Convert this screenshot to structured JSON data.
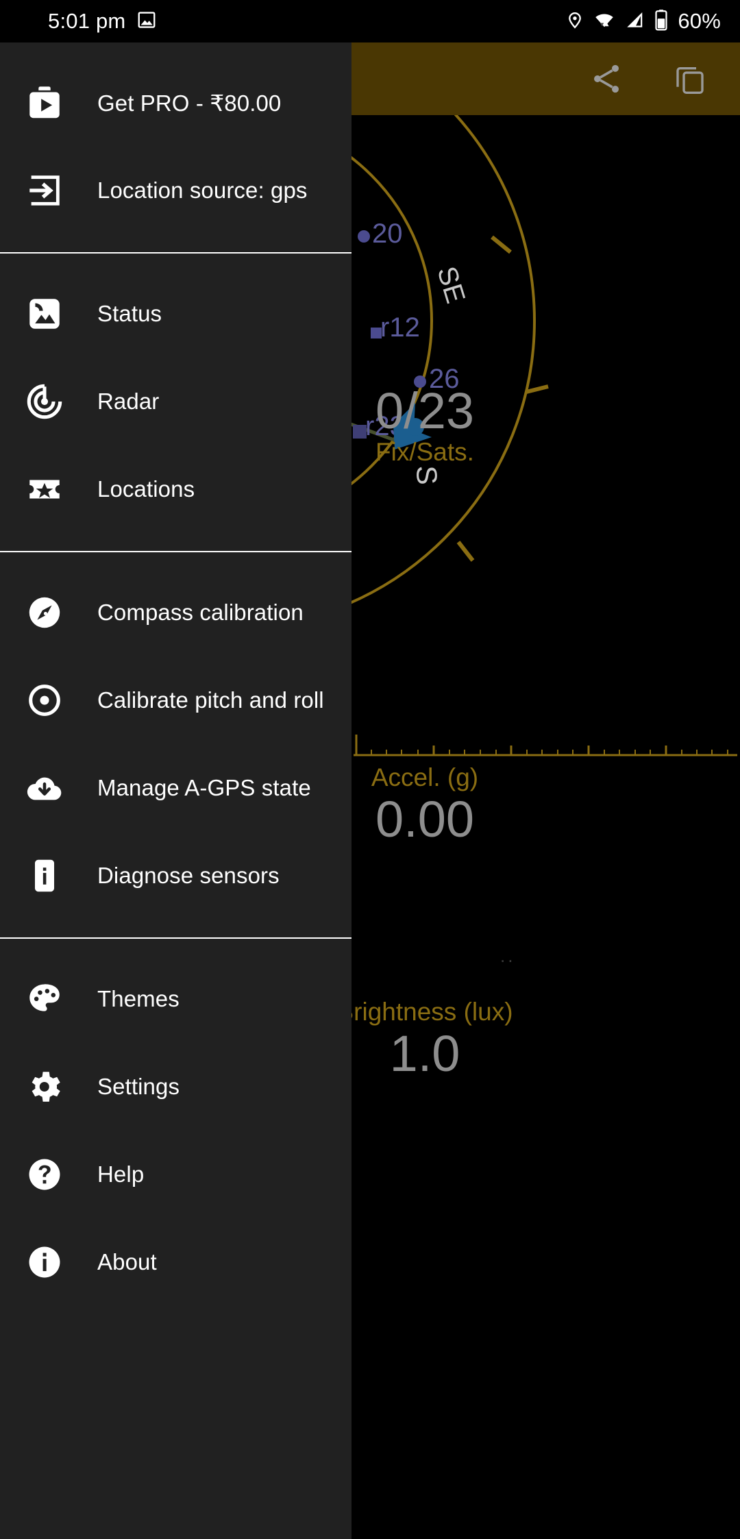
{
  "statusbar": {
    "clock": "5:01 pm",
    "screenshot_icon": "image-icon",
    "location_icon": "location-pin-icon",
    "wifi_icon": "wifi-icon",
    "cellular_icon": "cellular-signal-icon",
    "battery_icon": "battery-icon",
    "battery_percent": "60%"
  },
  "appbar": {
    "background_color": "#4a3703",
    "share_label": "share-icon",
    "copy_label": "copy-icon"
  },
  "radar": {
    "compass_labels": [
      "SE",
      "S"
    ],
    "satellites": [
      {
        "id": "20",
        "shape": "circle"
      },
      {
        "id": "r12",
        "shape": "square"
      },
      {
        "id": "26",
        "shape": "circle"
      },
      {
        "id": "r23",
        "shape": "square"
      }
    ],
    "ring_color": "#8a6d12",
    "sat_color": "#4b4b8f",
    "heading_arrow_color": "#1b5e8f"
  },
  "readouts": [
    {
      "value": "0/23",
      "label": "Fix/Sats."
    },
    {
      "value": "0.00",
      "label": "Accel. (g)"
    },
    {
      "value": "1.0",
      "label": "Brightness (lux)"
    }
  ],
  "colors": {
    "drawer_bg": "#212121",
    "accent_amber": "#8a6d12",
    "value_grey": "#8e8e8e",
    "divider": "#ffffff"
  },
  "drawer": {
    "sections": [
      {
        "items": [
          {
            "label": "Get PRO - ₹80.00",
            "icon": "play-store-briefcase-icon"
          },
          {
            "label": "Location source: gps",
            "icon": "login-arrow-icon"
          }
        ]
      },
      {
        "items": [
          {
            "label": "Status",
            "icon": "image-landscape-icon"
          },
          {
            "label": "Radar",
            "icon": "radar-icon"
          },
          {
            "label": "Locations",
            "icon": "ticket-star-icon"
          }
        ]
      },
      {
        "items": [
          {
            "label": "Compass calibration",
            "icon": "compass-icon"
          },
          {
            "label": "Calibrate pitch and roll",
            "icon": "target-dot-icon"
          },
          {
            "label": "Manage A-GPS state",
            "icon": "cloud-download-icon"
          },
          {
            "label": "Diagnose sensors",
            "icon": "phone-info-icon"
          }
        ]
      },
      {
        "items": [
          {
            "label": "Themes",
            "icon": "palette-icon"
          },
          {
            "label": "Settings",
            "icon": "gear-icon"
          },
          {
            "label": "Help",
            "icon": "help-circle-icon"
          },
          {
            "label": "About",
            "icon": "info-circle-icon"
          }
        ]
      }
    ]
  }
}
